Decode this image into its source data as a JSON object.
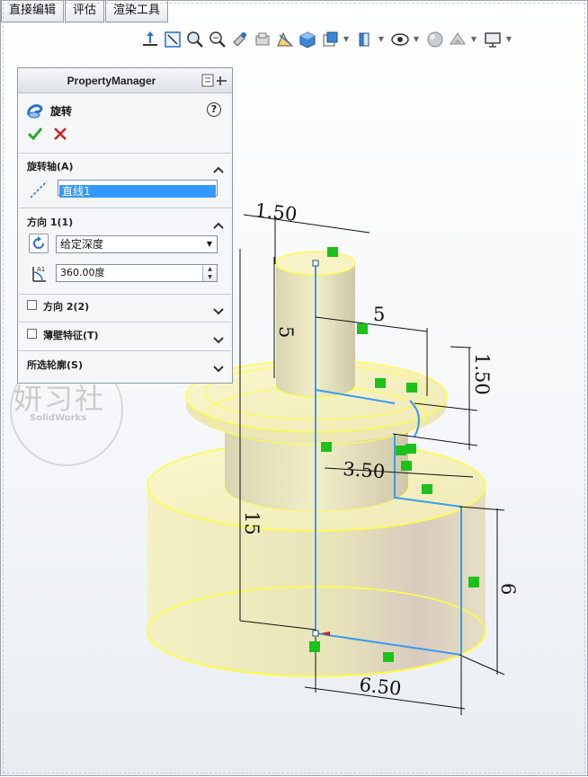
{
  "tabs": [
    "直接编辑",
    "评估",
    "渲染工具"
  ],
  "view_toolbar": {
    "icons": [
      "normal-to-icon",
      "zoom-to-fit-icon",
      "zoom-to-area-icon",
      "zoom-in-out-icon",
      "rotate-icon",
      "pan-icon",
      "section-view-icon",
      "view-orientation-icon",
      "display-style-icon",
      "hide-show-icon",
      "edit-appearance-icon",
      "apply-scene-icon",
      "view-settings-icon",
      "monitor-icon"
    ]
  },
  "property_manager": {
    "title": "PropertyManager",
    "feature_name": "旋转",
    "help": "?",
    "sections": {
      "axis": {
        "title": "旋转轴(A)",
        "value": "直线1"
      },
      "direction1": {
        "title": "方向 1(1)",
        "end_condition": "给定深度",
        "angle": "360.00度"
      },
      "direction2": {
        "title": "方向 2(2)"
      },
      "thin": {
        "title": "薄壁特征(T)"
      },
      "contours": {
        "title": "所选轮廓(S)"
      }
    }
  },
  "dimensions": {
    "top_width": "1.50",
    "top_height": "5",
    "top_offset": "5",
    "flange_height": "1.50",
    "mid_width": "3.50",
    "total_height": "15",
    "base_height": "6",
    "base_radius": "6.50"
  },
  "watermark": {
    "text": "妍习社",
    "sub": "SolidWorks"
  },
  "colors": {
    "sketch_blue": "#3a9bf0",
    "model_yellow": "#f4f0b6",
    "edge_yellow": "#ffff3a",
    "relation_green": "#1cc11c",
    "selection_blue": "#3399ff"
  }
}
